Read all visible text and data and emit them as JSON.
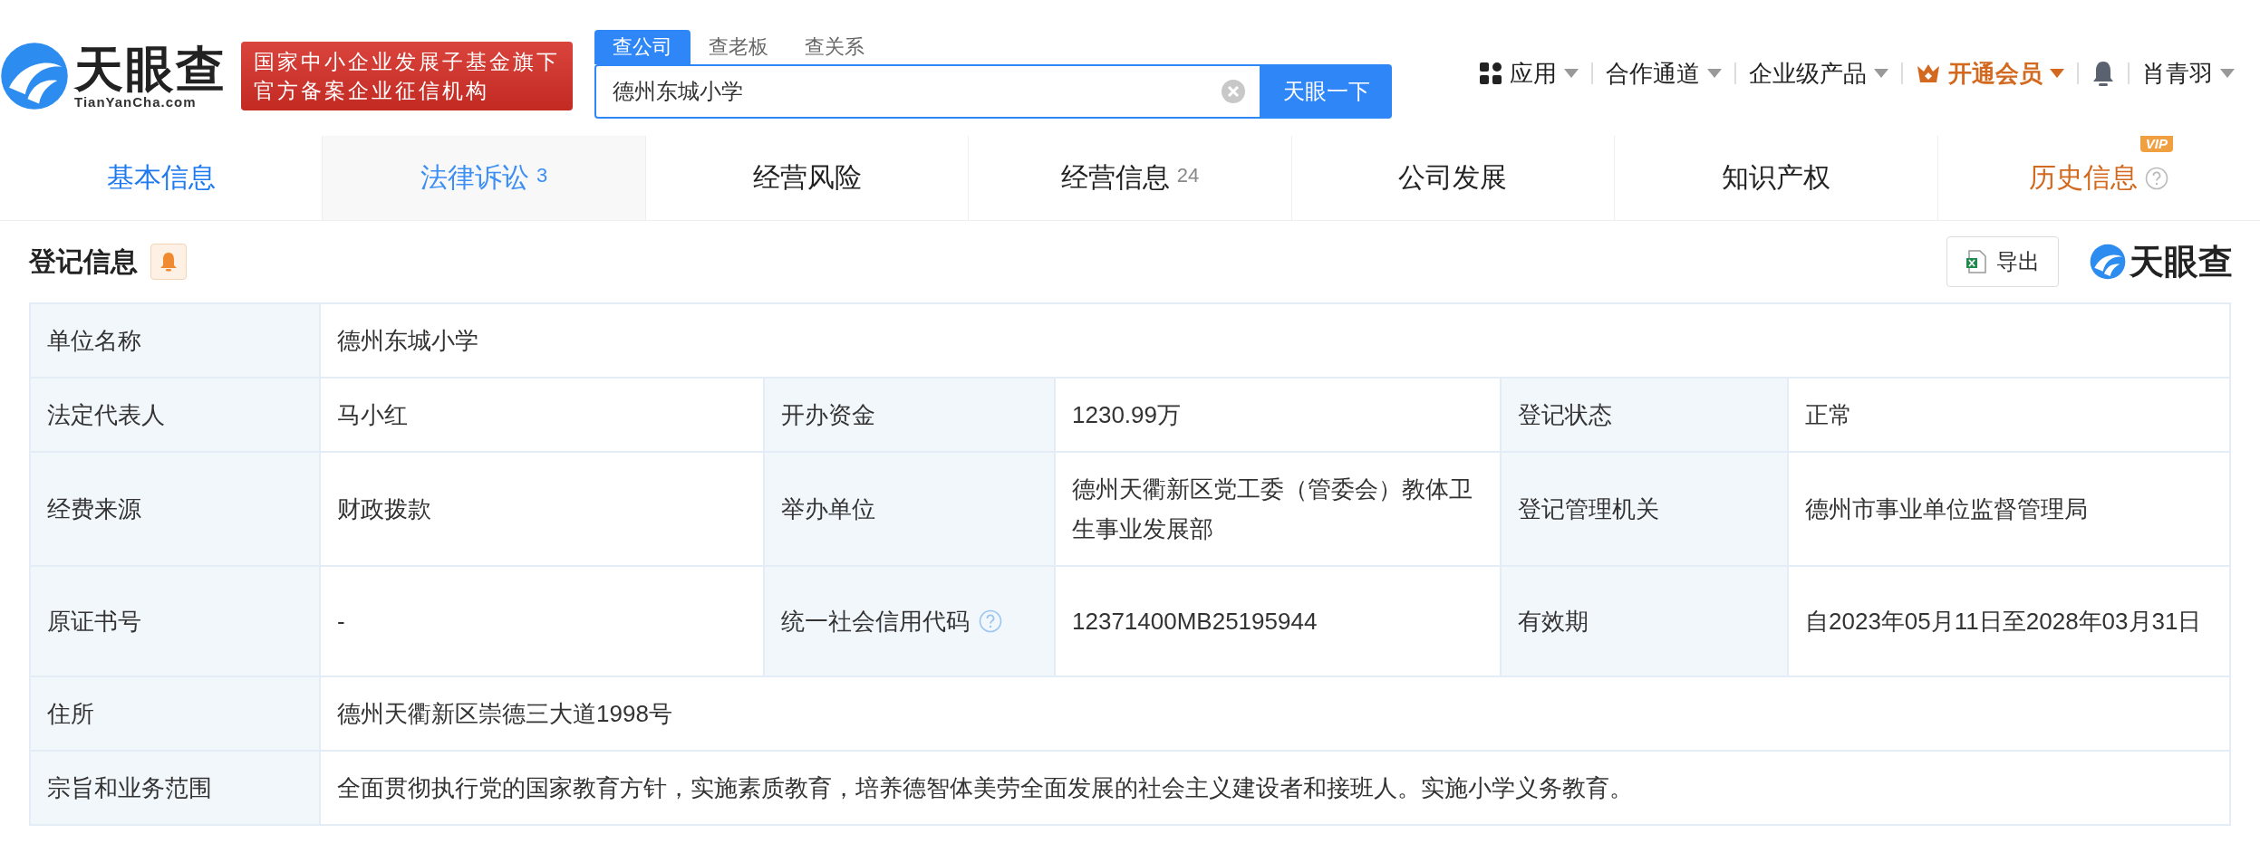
{
  "header": {
    "logo_text": "天眼查",
    "logo_domain": "TianYanCha.com",
    "badge_lines": [
      "国家中小企业发展子基金旗下",
      "官方备案企业征信机构"
    ],
    "search_tabs": [
      {
        "label": "查公司",
        "selected": true
      },
      {
        "label": "查老板",
        "selected": false
      },
      {
        "label": "查关系",
        "selected": false
      }
    ],
    "search": {
      "value": "德州东城小学",
      "button": "天眼一下"
    },
    "nav": [
      {
        "kind": "apps",
        "label": "应用"
      },
      {
        "kind": "plain",
        "label": "合作通道"
      },
      {
        "kind": "plain",
        "label": "企业级产品"
      },
      {
        "kind": "vip",
        "label": "开通会员"
      },
      {
        "kind": "bell"
      },
      {
        "kind": "plain",
        "label": "肖青羽"
      }
    ]
  },
  "tabs": [
    {
      "label": "基本信息",
      "selected": true,
      "highlighted": false,
      "kind": "normal"
    },
    {
      "label": "法律诉讼",
      "count": "3",
      "selected": false,
      "highlighted": true,
      "kind": "normal"
    },
    {
      "label": "经营风险",
      "selected": false,
      "highlighted": false,
      "kind": "normal"
    },
    {
      "label": "经营信息",
      "count": "24",
      "selected": false,
      "highlighted": false,
      "kind": "normal"
    },
    {
      "label": "公司发展",
      "selected": false,
      "highlighted": false,
      "kind": "normal"
    },
    {
      "label": "知识产权",
      "selected": false,
      "highlighted": false,
      "kind": "normal"
    },
    {
      "label": "历史信息",
      "selected": false,
      "highlighted": false,
      "kind": "vip",
      "badge": "VIP"
    }
  ],
  "section": {
    "title": "登记信息",
    "export_button": "导出",
    "brand": "天眼查"
  },
  "table": {
    "rows": [
      [
        {
          "label": "单位名称",
          "value": "德州东城小学"
        }
      ],
      [
        {
          "label": "法定代表人",
          "value": "马小红"
        },
        {
          "label": "开办资金",
          "value": "1230.99万"
        },
        {
          "label": "登记状态",
          "value": "正常"
        }
      ],
      [
        {
          "label": "经费来源",
          "value": "财政拨款"
        },
        {
          "label": "举办单位",
          "value": "德州天衢新区党工委（管委会）教体卫生事业发展部"
        },
        {
          "label": "登记管理机关",
          "value": "德州市事业单位监督管理局"
        }
      ],
      [
        {
          "label": "原证书号",
          "value": "-"
        },
        {
          "label": "统一社会信用代码",
          "value": "12371400MB25195944",
          "help": true
        },
        {
          "label": "有效期",
          "value": "自2023年05月11日至2028年03月31日"
        }
      ],
      [
        {
          "label": "住所",
          "value": "德州天衢新区崇德三大道1998号"
        }
      ],
      [
        {
          "label": "宗旨和业务范围",
          "value": "全面贯彻执行党的国家教育方针，实施素质教育，培养德智体美劳全面发展的社会主义建设者和接班人。实施小学义务教育。"
        }
      ]
    ]
  }
}
